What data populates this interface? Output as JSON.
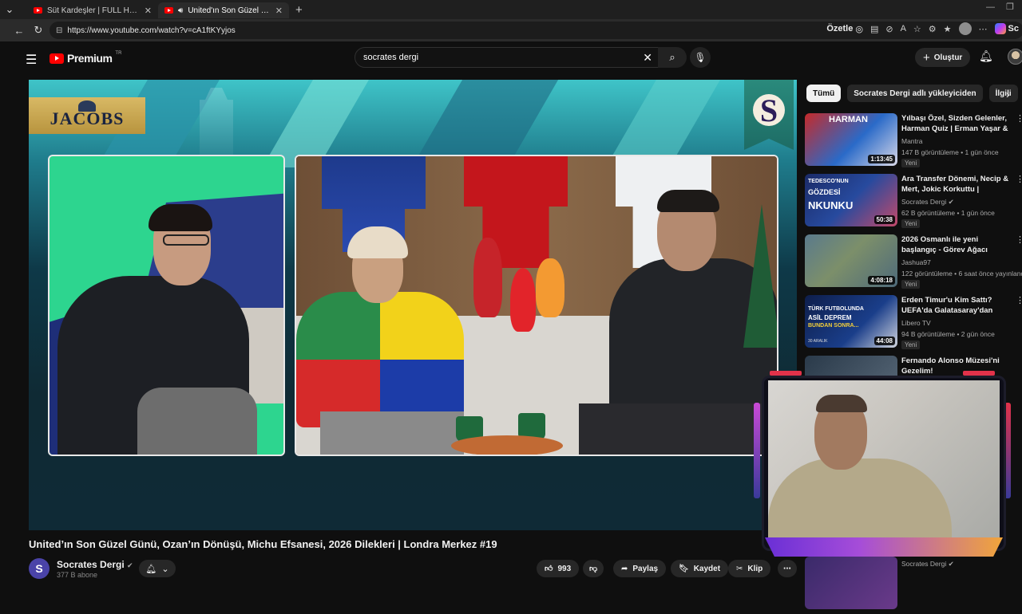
{
  "browser": {
    "tabs": [
      {
        "title": "Süt Kardeşler | FULL HD - YouTube",
        "active": false
      },
      {
        "title": "United'ın Son Güzel Günü, Oz",
        "active": true
      }
    ],
    "url": "https://www.youtube.com/watch?v=cA1ftKYyjos",
    "summarize_label": "Özetle",
    "profile_label": "Sc"
  },
  "header": {
    "logo_text": "Premium",
    "logo_region": "TR",
    "search_value": "socrates dergi",
    "create_label": "Oluştur"
  },
  "player": {
    "sponsor": "JACOBS",
    "flag_letter": "S"
  },
  "video": {
    "title": "United’ın Son Güzel Günü, Ozan’ın Dönüşü, Michu Efsanesi, 2026 Dilekleri | Londra Merkez #19",
    "channel": "Socrates Dergi",
    "channel_initial": "S",
    "subscribers": "377 B abone",
    "likes": "993",
    "share_label": "Paylaş",
    "save_label": "Kaydet",
    "clip_label": "Klip"
  },
  "sidebar": {
    "chips": [
      "Tümü",
      "Socrates Dergi adlı yükleyiciden",
      "İlgili"
    ],
    "recommendations": [
      {
        "title": "Yılbaşı Özel, Sizden Gelenler, Harman Quiz | Erman Yaşar & ...",
        "channel": "Mantra",
        "meta": "147 B görüntüleme • 1 gün önce",
        "badge": "Yeni",
        "duration": "1:13:45",
        "verified": false
      },
      {
        "title": "Ara Transfer Dönemi, Necip & Mert, Jokic Korkuttu | Mehmet...",
        "channel": "Socrates Dergi",
        "meta": "62 B görüntüleme • 1 gün önce",
        "badge": "Yeni",
        "duration": "50:38",
        "verified": true
      },
      {
        "title": "2026 Osmanlı ile yeni başlangıç - Görev Ağacı tamamlamaca",
        "channel": "Jashua97",
        "meta": "122 görüntüleme • 6 saat önce yayınlandı",
        "badge": "Yeni",
        "duration": "4:08:18",
        "verified": false
      },
      {
        "title": "Erden Timur'u Kim Sattı? UEFA'da Galatasaray'dan Daha...",
        "channel": "Libero TV",
        "meta": "94 B görüntüleme • 2 gün önce",
        "badge": "Yeni",
        "duration": "44:08",
        "verified": false
      },
      {
        "title": "Fernando Alonso Müzesi'ni Gezelim!",
        "channel": "",
        "meta": "",
        "badge": "",
        "duration": "",
        "verified": false
      },
      {
        "title": "",
        "channel": "Socrates Dergi",
        "meta": "",
        "badge": "",
        "duration": "",
        "verified": true
      }
    ]
  },
  "thumb_text": {
    "r1": "HARMAN",
    "r2a": "TEDESCO'NUN",
    "r2b": "GÖZDESİ",
    "r2c": "NKUNKU",
    "r4a": "TÜRK FUTBOLUNDA",
    "r4b": "ASİL DEPREM",
    "r4c": "BUNDAN SONRA...",
    "r4d": "30 ARALIK"
  }
}
